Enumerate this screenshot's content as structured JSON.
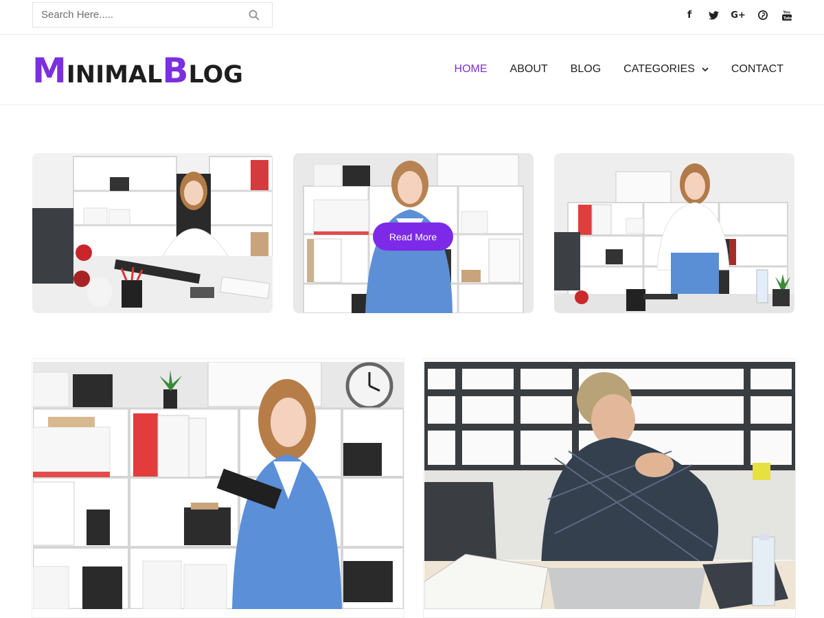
{
  "search": {
    "placeholder": "Search Here....."
  },
  "social": [
    {
      "icon": "facebook-icon",
      "glyph": "f"
    },
    {
      "icon": "twitter-icon",
      "glyph": "🐦"
    },
    {
      "icon": "google-plus-icon",
      "glyph": "G+"
    },
    {
      "icon": "pinterest-icon",
      "glyph": "P"
    },
    {
      "icon": "youtube-icon",
      "glyph": "▶"
    }
  ],
  "logo": {
    "part1_big": "M",
    "part1_small": "INIMAL",
    "part2_big": "B",
    "part2_small": "LOG"
  },
  "nav": {
    "home": "HOME",
    "about": "ABOUT",
    "blog": "BLOG",
    "categories": "CATEGORIES",
    "contact": "CONTACT"
  },
  "cards": {
    "read_more": "Read More"
  },
  "colors": {
    "accent": "#7b2fe0",
    "button": "#7d2ae8"
  }
}
